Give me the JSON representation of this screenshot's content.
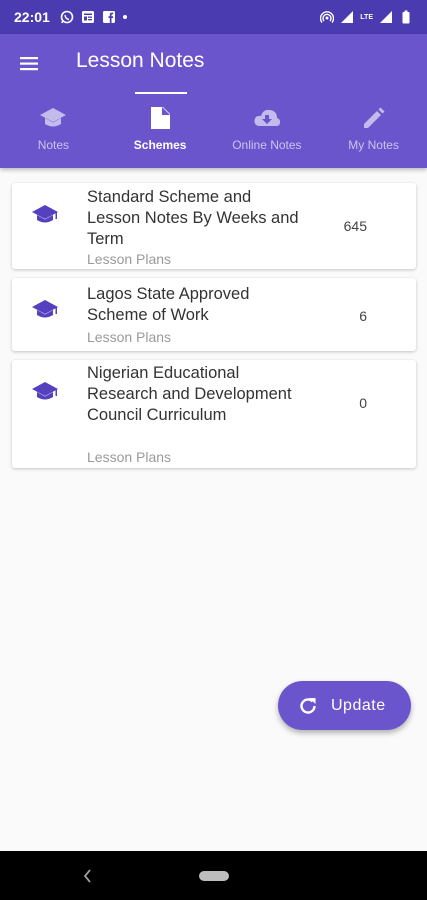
{
  "status_bar": {
    "time": "22:01",
    "network_label": "LTE",
    "icons_left": [
      "whatsapp-icon",
      "news-icon",
      "facebook-icon",
      "dot-icon"
    ],
    "icons_right": [
      "hotspot-icon",
      "wifi-signal-icon",
      "lte-signal-icon",
      "battery-icon"
    ]
  },
  "app_bar": {
    "title": "Lesson Notes",
    "color": "#6a55cc",
    "menu_icon": "menu-icon"
  },
  "tabs": [
    {
      "label": "Notes",
      "icon": "school-icon",
      "active": false
    },
    {
      "label": "Schemes",
      "icon": "note-icon",
      "active": true
    },
    {
      "label": "Online Notes",
      "icon": "cloud-download-icon",
      "active": false
    },
    {
      "label": "My Notes",
      "icon": "pencil-icon",
      "active": false
    }
  ],
  "list": {
    "items": [
      {
        "title": "Standard Scheme and Lesson Notes By Weeks and Term",
        "subtitle": "Lesson Plans",
        "count": "645",
        "icon": "graduation-cap-icon"
      },
      {
        "title": "Lagos State Approved Scheme of Work",
        "subtitle": "Lesson Plans",
        "count": "6",
        "icon": "graduation-cap-icon"
      },
      {
        "title": "Nigerian Educational Research and Development Council Curriculum",
        "subtitle": "Lesson Plans",
        "count": "0",
        "icon": "graduation-cap-icon"
      }
    ]
  },
  "fab": {
    "label": "Update",
    "icon": "refresh-icon"
  },
  "colors": {
    "accent": "#6a55cc",
    "status_bar": "#4b3bb0",
    "icon": "#5540c0"
  }
}
